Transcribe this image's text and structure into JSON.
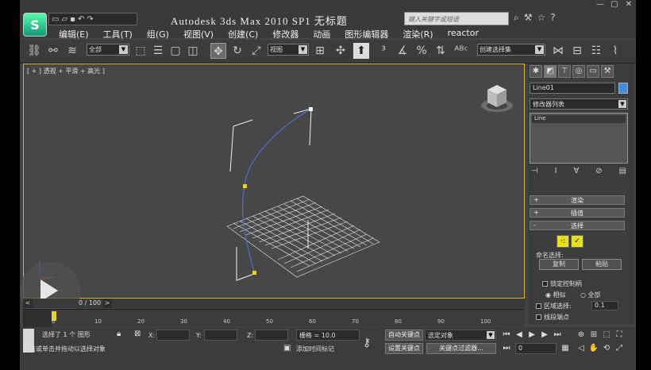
{
  "window": {
    "title": "Autodesk 3ds Max   2010 SP1    无标题",
    "logo": "3ds-max-logo-icon",
    "controls": [
      "▢",
      "—",
      "✕"
    ]
  },
  "qat": {
    "icons": [
      "new-file-icon",
      "open-file-icon",
      "save-icon",
      "undo-icon",
      "redo-icon"
    ]
  },
  "help_search": {
    "placeholder": "键入关键字或短语"
  },
  "menu": [
    "编辑(E)",
    "工具(T)",
    "组(G)",
    "视图(V)",
    "创建(C)",
    "修改器",
    "动画",
    "图形编辑器",
    "渲染(R)",
    "reactor"
  ],
  "toolbar": {
    "selection_filter": "全部",
    "ref_coord": "视图",
    "named_sel": "创建选择集"
  },
  "viewport": {
    "label": "[ + ] 透视 + 平滑 + 高光 ]",
    "border_color": "#d2b42c"
  },
  "command_panel": {
    "object_name": "Line01",
    "object_color": "#3f8ee0",
    "modifier_list": "修改器列表",
    "stack_item": "Line",
    "rollouts": [
      {
        "sign": "+",
        "label": "渲染"
      },
      {
        "sign": "+",
        "label": "插值"
      },
      {
        "sign": "-",
        "label": "选择"
      }
    ],
    "named_sel_label": "命名选择:",
    "copy_button": "复制",
    "paste_button": "粘贴",
    "lock_handles": "锁定控制柄",
    "similar": "相似",
    "all": "全部",
    "area_select": "区域选择:",
    "area_value": "0.1",
    "segment_end": "线段端点"
  },
  "timeline": {
    "position": "0 / 100",
    "ticks": [
      "0",
      "10",
      "20",
      "30",
      "40",
      "50",
      "60",
      "70",
      "80",
      "90",
      "100"
    ]
  },
  "status": {
    "selected": "选择了 1 个 图形",
    "prompt": "单击或单击并拖动以选择对象",
    "x_label": "X:",
    "y_label": "Y:",
    "z_label": "Z:",
    "grid": "栅格 = 10.0",
    "add_time_tag": "添加时间标记",
    "auto_key": "自动关键点",
    "set_key": "设置关键点",
    "key_mode": "选定对象",
    "key_filters": "关键点过滤器...",
    "frame": "0"
  }
}
